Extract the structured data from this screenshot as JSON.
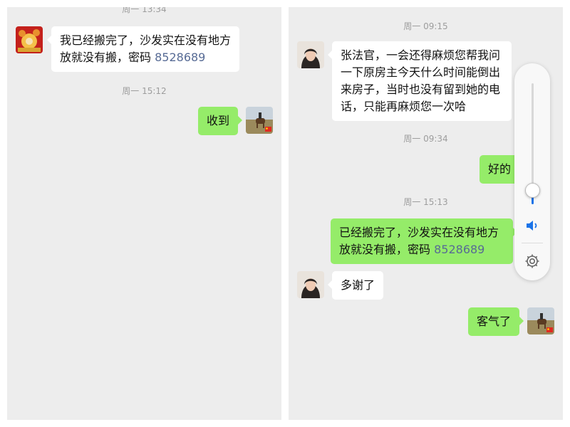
{
  "left": {
    "messages": [
      {
        "time": "周一 13:34"
      },
      {
        "direction": "in",
        "text": "我已经搬完了，沙发实在没有地方放就没有搬，密码 ",
        "password": "8528689"
      },
      {
        "time": "周一 15:12"
      },
      {
        "direction": "out",
        "text": "收到"
      }
    ]
  },
  "right": {
    "messages": [
      {
        "time": "周一 09:15"
      },
      {
        "direction": "in",
        "text": "张法官，一会还得麻烦您帮我问一下原房主今天什么时间能倒出来房子，当时也没有留到她的电话，只能再麻烦您一次哈"
      },
      {
        "time": "周一 09:34"
      },
      {
        "direction": "out",
        "text": "好的"
      },
      {
        "time": "周一 15:13"
      },
      {
        "direction": "out",
        "text": "已经搬完了，沙发实在没有地方放就没有搬，密码 ",
        "password": "8528689"
      },
      {
        "direction": "in",
        "text": "多谢了"
      },
      {
        "direction": "out",
        "text": "客气了"
      }
    ]
  },
  "volume_panel": {
    "level": 0.12,
    "speaker_icon": "speaker-icon",
    "settings_icon": "gear-icon"
  },
  "colors": {
    "background": "#ededed",
    "outgoing_bubble": "#95ec69",
    "incoming_bubble": "#ffffff",
    "link": "#576b95",
    "accent": "#1a73e8"
  }
}
